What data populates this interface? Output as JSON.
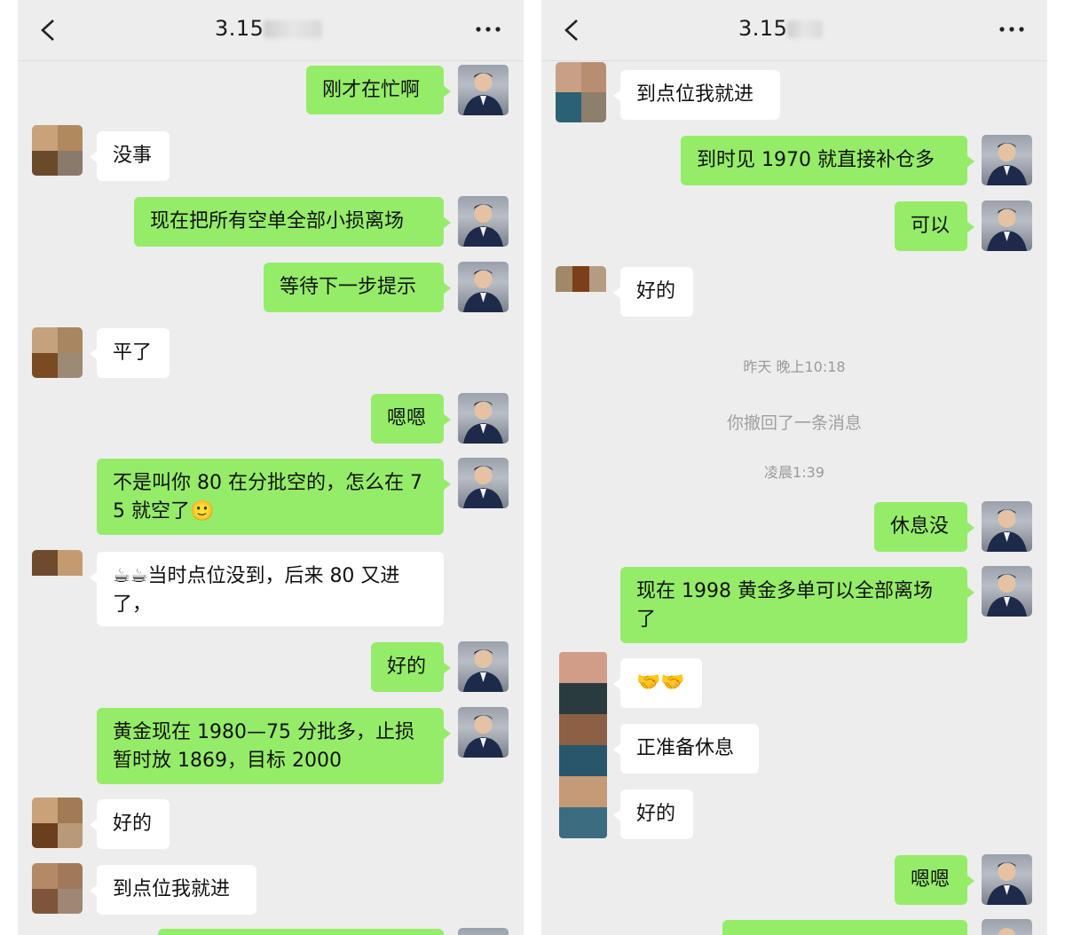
{
  "screens": [
    {
      "title": "3.15",
      "back_icon": "chevron-left-icon",
      "more_icon": "more-icon",
      "messages": [
        {
          "from": "me",
          "text": "刚才在忙啊"
        },
        {
          "from": "other",
          "text": "没事"
        },
        {
          "from": "me",
          "text": "现在把所有空单全部小损离场"
        },
        {
          "from": "me",
          "text": "等待下一步提示"
        },
        {
          "from": "other",
          "text": "平了"
        },
        {
          "from": "me",
          "text": "嗯嗯"
        },
        {
          "from": "me",
          "text": "不是叫你 80 在分批空的，怎么在 75 就空了🙂"
        },
        {
          "from": "other",
          "text": "☕☕当时点位没到，后来 80 又进了，"
        },
        {
          "from": "me",
          "text": "好的"
        },
        {
          "from": "me",
          "text": "黄金现在 1980—75 分批多，止损暂时放 1869，目标 2000"
        },
        {
          "from": "other",
          "text": "好的"
        },
        {
          "from": "other",
          "text": "到点位我就进"
        }
      ]
    },
    {
      "title": "3.15",
      "back_icon": "chevron-left-icon",
      "more_icon": "more-icon",
      "messages": [
        {
          "from": "other",
          "text": "到点位我就进"
        },
        {
          "from": "me",
          "text": "到时见 1970 就直接补仓多"
        },
        {
          "from": "me",
          "text": "可以"
        },
        {
          "from": "other",
          "text": "好的"
        },
        {
          "from": "me",
          "text": "休息没"
        },
        {
          "from": "me",
          "text": "现在 1998 黄金多单可以全部离场了"
        },
        {
          "from": "other",
          "text": "🤝🤝"
        },
        {
          "from": "other",
          "text": "正准备休息"
        },
        {
          "from": "other",
          "text": "好的"
        },
        {
          "from": "me",
          "text": "嗯嗯"
        }
      ],
      "system": {
        "time1": "昨天 晚上10:18",
        "recall": "你撤回了一条消息",
        "time2": "凌晨1:39"
      }
    }
  ],
  "colors": {
    "chat_bg": "#ededed",
    "my_bubble": "#95ec69",
    "their_bubble": "#ffffff"
  }
}
